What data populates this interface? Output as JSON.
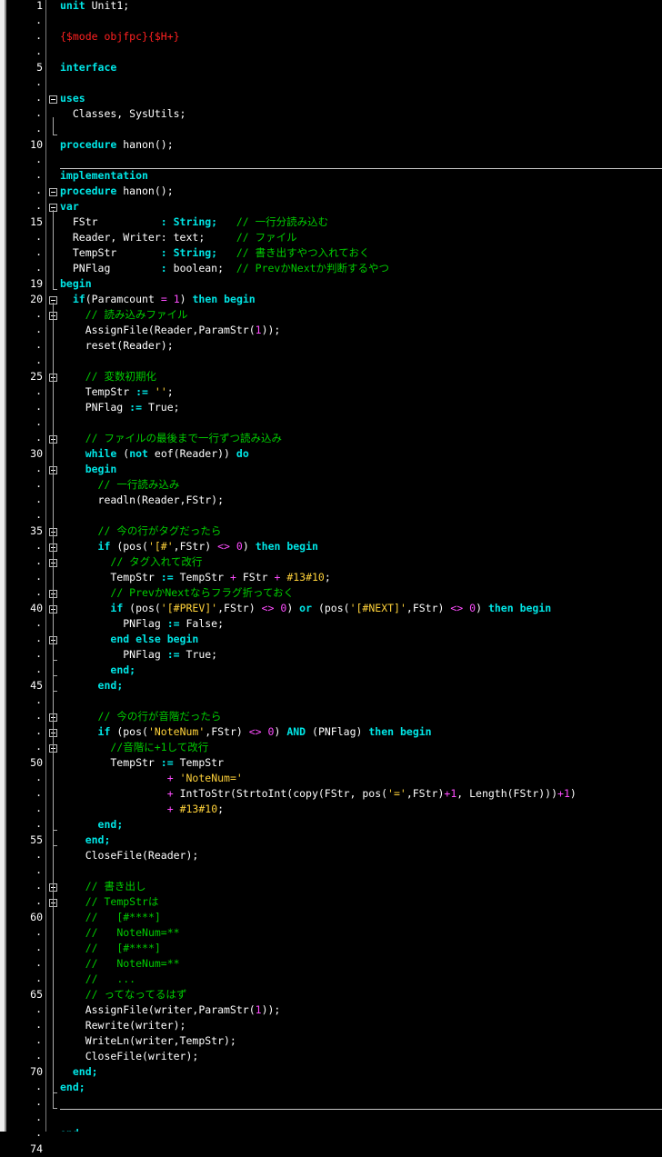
{
  "editor": {
    "colors": {
      "background": "#000000",
      "keyword": "#00e6e6",
      "comment": "#00cc00",
      "directive": "#ff2020",
      "string": "#ffd23a",
      "number": "#ff4dff",
      "text": "#ffffff"
    },
    "gutter_markers": [
      {
        "label": "1"
      },
      {
        "label": "."
      },
      {
        "label": "."
      },
      {
        "label": "."
      },
      {
        "label": "5"
      },
      {
        "label": "."
      },
      {
        "label": "."
      },
      {
        "label": "."
      },
      {
        "label": "."
      },
      {
        "label": "10"
      },
      {
        "label": "."
      },
      {
        "label": "."
      },
      {
        "label": "."
      },
      {
        "label": "."
      },
      {
        "label": "15"
      },
      {
        "label": "."
      },
      {
        "label": "."
      },
      {
        "label": "."
      },
      {
        "label": "19"
      },
      {
        "label": "20"
      },
      {
        "label": "."
      },
      {
        "label": "."
      },
      {
        "label": "."
      },
      {
        "label": "."
      },
      {
        "label": "25"
      },
      {
        "label": "."
      },
      {
        "label": "."
      },
      {
        "label": "."
      },
      {
        "label": "."
      },
      {
        "label": "30"
      },
      {
        "label": "."
      },
      {
        "label": "."
      },
      {
        "label": "."
      },
      {
        "label": "."
      },
      {
        "label": "35"
      },
      {
        "label": "."
      },
      {
        "label": "."
      },
      {
        "label": "."
      },
      {
        "label": "."
      },
      {
        "label": "40"
      },
      {
        "label": "."
      },
      {
        "label": "."
      },
      {
        "label": "."
      },
      {
        "label": "."
      },
      {
        "label": "45"
      },
      {
        "label": "."
      },
      {
        "label": "."
      },
      {
        "label": "."
      },
      {
        "label": "."
      },
      {
        "label": "50"
      },
      {
        "label": "."
      },
      {
        "label": "."
      },
      {
        "label": "."
      },
      {
        "label": "."
      },
      {
        "label": "55"
      },
      {
        "label": "."
      },
      {
        "label": "."
      },
      {
        "label": "."
      },
      {
        "label": "."
      },
      {
        "label": "60"
      },
      {
        "label": "."
      },
      {
        "label": "."
      },
      {
        "label": "."
      },
      {
        "label": "."
      },
      {
        "label": "65"
      },
      {
        "label": "."
      },
      {
        "label": "."
      },
      {
        "label": "."
      },
      {
        "label": "."
      },
      {
        "label": "70"
      },
      {
        "label": "."
      },
      {
        "label": "."
      },
      {
        "label": "."
      },
      {
        "label": "."
      },
      {
        "label": "74"
      }
    ],
    "lines": [
      [
        [
          "kw",
          "unit"
        ],
        [
          "tx",
          " Unit1;"
        ]
      ],
      [],
      [
        [
          "dir",
          "{$mode objfpc}{$H+}"
        ]
      ],
      [],
      [
        [
          "kw",
          "interface"
        ]
      ],
      [],
      [
        [
          "kw",
          "uses"
        ]
      ],
      [
        [
          "tx",
          "  Classes, SysUtils;"
        ]
      ],
      [],
      [
        [
          "kw",
          "procedure"
        ],
        [
          "tx",
          " hanon();"
        ]
      ],
      [],
      [
        [
          "kw",
          "implementation"
        ]
      ],
      [
        [
          "kw",
          "procedure"
        ],
        [
          "tx",
          " hanon();"
        ]
      ],
      [
        [
          "kw",
          "var"
        ]
      ],
      [
        [
          "tx",
          "  FStr          "
        ],
        [
          "kw",
          ": String;"
        ],
        [
          "tx",
          "   "
        ],
        [
          "cm",
          "// 一行分読み込む"
        ]
      ],
      [
        [
          "tx",
          "  Reader, Writer: text;     "
        ],
        [
          "cm",
          "// ファイル"
        ]
      ],
      [
        [
          "tx",
          "  TempStr       "
        ],
        [
          "kw",
          ": String;"
        ],
        [
          "tx",
          "   "
        ],
        [
          "cm",
          "// 書き出すやつ入れておく"
        ]
      ],
      [
        [
          "tx",
          "  PNFlag        "
        ],
        [
          "kw",
          ":"
        ],
        [
          "tx",
          " boolean;  "
        ],
        [
          "cm",
          "// PrevかNextか判断するやつ"
        ]
      ],
      [
        [
          "kw",
          "begin"
        ]
      ],
      [
        [
          "tx",
          "  "
        ],
        [
          "kw",
          "if"
        ],
        [
          "tx",
          "(Paramcount "
        ],
        [
          "sym",
          "="
        ],
        [
          "tx",
          " "
        ],
        [
          "nm",
          "1"
        ],
        [
          "tx",
          ") "
        ],
        [
          "kw",
          "then begin"
        ]
      ],
      [
        [
          "tx",
          "    "
        ],
        [
          "cm",
          "// 読み込みファイル"
        ]
      ],
      [
        [
          "tx",
          "    AssignFile(Reader,ParamStr("
        ],
        [
          "nm",
          "1"
        ],
        [
          "tx",
          "));"
        ]
      ],
      [
        [
          "tx",
          "    reset(Reader);"
        ]
      ],
      [],
      [
        [
          "tx",
          "    "
        ],
        [
          "cm",
          "// 変数初期化"
        ]
      ],
      [
        [
          "tx",
          "    TempStr "
        ],
        [
          "kw",
          ":="
        ],
        [
          "tx",
          " "
        ],
        [
          "st",
          "''"
        ],
        [
          "tx",
          ";"
        ]
      ],
      [
        [
          "tx",
          "    PNFlag "
        ],
        [
          "kw",
          ":="
        ],
        [
          "tx",
          " True;"
        ]
      ],
      [],
      [
        [
          "tx",
          "    "
        ],
        [
          "cm",
          "// ファイルの最後まで一行ずつ読み込み"
        ]
      ],
      [
        [
          "tx",
          "    "
        ],
        [
          "kw",
          "while"
        ],
        [
          "tx",
          " ("
        ],
        [
          "kw",
          "not"
        ],
        [
          "tx",
          " eof(Reader)) "
        ],
        [
          "kw",
          "do"
        ]
      ],
      [
        [
          "tx",
          "    "
        ],
        [
          "kw",
          "begin"
        ]
      ],
      [
        [
          "tx",
          "      "
        ],
        [
          "cm",
          "// 一行読み込み"
        ]
      ],
      [
        [
          "tx",
          "      readln(Reader,FStr);"
        ]
      ],
      [],
      [
        [
          "tx",
          "      "
        ],
        [
          "cm",
          "// 今の行がタグだったら"
        ]
      ],
      [
        [
          "tx",
          "      "
        ],
        [
          "kw",
          "if"
        ],
        [
          "tx",
          " (pos("
        ],
        [
          "st",
          "'[#'"
        ],
        [
          "tx",
          ",FStr) "
        ],
        [
          "sym",
          "<>"
        ],
        [
          "tx",
          " "
        ],
        [
          "nm",
          "0"
        ],
        [
          "tx",
          ") "
        ],
        [
          "kw",
          "then begin"
        ]
      ],
      [
        [
          "tx",
          "        "
        ],
        [
          "cm",
          "// タグ入れて改行"
        ]
      ],
      [
        [
          "tx",
          "        TempStr "
        ],
        [
          "kw",
          ":="
        ],
        [
          "tx",
          " TempStr "
        ],
        [
          "sym",
          "+"
        ],
        [
          "tx",
          " FStr "
        ],
        [
          "sym",
          "+"
        ],
        [
          "tx",
          " "
        ],
        [
          "st",
          "#13#10"
        ],
        [
          "tx",
          ";"
        ]
      ],
      [
        [
          "tx",
          "        "
        ],
        [
          "cm",
          "// PrevかNextならフラグ折っておく"
        ]
      ],
      [
        [
          "tx",
          "        "
        ],
        [
          "kw",
          "if"
        ],
        [
          "tx",
          " (pos("
        ],
        [
          "st",
          "'[#PREV]'"
        ],
        [
          "tx",
          ",FStr) "
        ],
        [
          "sym",
          "<>"
        ],
        [
          "tx",
          " "
        ],
        [
          "nm",
          "0"
        ],
        [
          "tx",
          ") "
        ],
        [
          "kw",
          "or"
        ],
        [
          "tx",
          " (pos("
        ],
        [
          "st",
          "'[#NEXT]'"
        ],
        [
          "tx",
          ",FStr) "
        ],
        [
          "sym",
          "<>"
        ],
        [
          "tx",
          " "
        ],
        [
          "nm",
          "0"
        ],
        [
          "tx",
          ") "
        ],
        [
          "kw",
          "then begin"
        ]
      ],
      [
        [
          "tx",
          "          PNFlag "
        ],
        [
          "kw",
          ":="
        ],
        [
          "tx",
          " False;"
        ]
      ],
      [
        [
          "tx",
          "        "
        ],
        [
          "kw",
          "end else begin"
        ]
      ],
      [
        [
          "tx",
          "          PNFlag "
        ],
        [
          "kw",
          ":="
        ],
        [
          "tx",
          " True;"
        ]
      ],
      [
        [
          "tx",
          "        "
        ],
        [
          "kw",
          "end;"
        ]
      ],
      [
        [
          "tx",
          "      "
        ],
        [
          "kw",
          "end;"
        ]
      ],
      [],
      [
        [
          "tx",
          "      "
        ],
        [
          "cm",
          "// 今の行が音階だったら"
        ]
      ],
      [
        [
          "tx",
          "      "
        ],
        [
          "kw",
          "if"
        ],
        [
          "tx",
          " (pos("
        ],
        [
          "st",
          "'NoteNum'"
        ],
        [
          "tx",
          ",FStr) "
        ],
        [
          "sym",
          "<>"
        ],
        [
          "tx",
          " "
        ],
        [
          "nm",
          "0"
        ],
        [
          "tx",
          ") "
        ],
        [
          "kw",
          "AND"
        ],
        [
          "tx",
          " (PNFlag) "
        ],
        [
          "kw",
          "then begin"
        ]
      ],
      [
        [
          "tx",
          "        "
        ],
        [
          "cm",
          "//音階に+1して改行"
        ]
      ],
      [
        [
          "tx",
          "        TempStr "
        ],
        [
          "kw",
          ":="
        ],
        [
          "tx",
          " TempStr"
        ]
      ],
      [
        [
          "tx",
          "                 "
        ],
        [
          "sym",
          "+"
        ],
        [
          "tx",
          " "
        ],
        [
          "st",
          "'NoteNum='"
        ]
      ],
      [
        [
          "tx",
          "                 "
        ],
        [
          "sym",
          "+"
        ],
        [
          "tx",
          " IntToStr(StrtoInt(copy(FStr, pos("
        ],
        [
          "st",
          "'='"
        ],
        [
          "tx",
          ",FStr)"
        ],
        [
          "sym",
          "+"
        ],
        [
          "nm",
          "1"
        ],
        [
          "tx",
          ", Length(FStr)))"
        ],
        [
          "sym",
          "+"
        ],
        [
          "nm",
          "1"
        ],
        [
          "tx",
          ")"
        ]
      ],
      [
        [
          "tx",
          "                 "
        ],
        [
          "sym",
          "+"
        ],
        [
          "tx",
          " "
        ],
        [
          "st",
          "#13#10"
        ],
        [
          "tx",
          ";"
        ]
      ],
      [
        [
          "tx",
          "      "
        ],
        [
          "kw",
          "end;"
        ]
      ],
      [
        [
          "tx",
          "    "
        ],
        [
          "kw",
          "end;"
        ]
      ],
      [
        [
          "tx",
          "    CloseFile(Reader);"
        ]
      ],
      [],
      [
        [
          "tx",
          "    "
        ],
        [
          "cm",
          "// 書き出し"
        ]
      ],
      [
        [
          "tx",
          "    "
        ],
        [
          "cm",
          "// TempStrは"
        ]
      ],
      [
        [
          "tx",
          "    "
        ],
        [
          "cm",
          "//   [#****]"
        ]
      ],
      [
        [
          "tx",
          "    "
        ],
        [
          "cm",
          "//   NoteNum=**"
        ]
      ],
      [
        [
          "tx",
          "    "
        ],
        [
          "cm",
          "//   [#****]"
        ]
      ],
      [
        [
          "tx",
          "    "
        ],
        [
          "cm",
          "//   NoteNum=**"
        ]
      ],
      [
        [
          "tx",
          "    "
        ],
        [
          "cm",
          "//   ..."
        ]
      ],
      [
        [
          "tx",
          "    "
        ],
        [
          "cm",
          "// ってなってるはず"
        ]
      ],
      [
        [
          "tx",
          "    AssignFile(writer,ParamStr("
        ],
        [
          "nm",
          "1"
        ],
        [
          "tx",
          "));"
        ]
      ],
      [
        [
          "tx",
          "    Rewrite(writer);"
        ]
      ],
      [
        [
          "tx",
          "    WriteLn(writer,TempStr);"
        ]
      ],
      [
        [
          "tx",
          "    CloseFile(writer);"
        ]
      ],
      [
        [
          "tx",
          "  "
        ],
        [
          "kw",
          "end;"
        ]
      ],
      [
        [
          "kw",
          "end;"
        ]
      ],
      [],
      [],
      [
        [
          "kw",
          "end."
        ]
      ],
      []
    ]
  }
}
